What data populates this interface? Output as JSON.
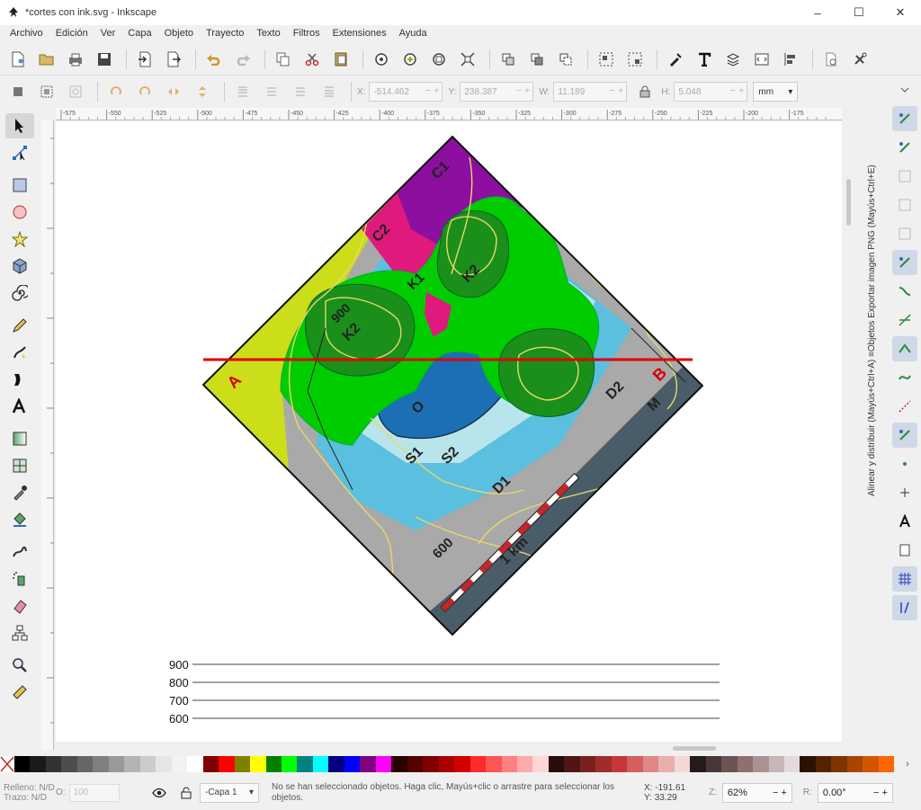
{
  "window": {
    "title": "*cortes con ink.svg - Inkscape",
    "controls": [
      "–",
      "☐",
      "✕"
    ]
  },
  "menu": [
    "Archivo",
    "Edición",
    "Ver",
    "Capa",
    "Objeto",
    "Trayecto",
    "Texto",
    "Filtros",
    "Extensiones",
    "Ayuda"
  ],
  "coords": {
    "x_label": "X:",
    "x_value": "-514.462",
    "y_label": "Y:",
    "y_value": "238.387",
    "w_label": "W:",
    "w_value": "11.189",
    "h_label": "H:",
    "h_value": "5.048",
    "unit": "mm"
  },
  "ruler": {
    "labels": [
      "-575",
      "-550",
      "-525",
      "-500",
      "-475",
      "-450",
      "-425",
      "-400",
      "-375",
      "-350",
      "-325",
      "-300",
      "-275",
      "-250",
      "-225",
      "-200",
      "-175"
    ]
  },
  "map": {
    "labels": {
      "c1": "C1",
      "c2": "C2",
      "k1": "K1",
      "k2a": "K2",
      "k2b": "K2",
      "c900": "900",
      "o": "O",
      "s1": "S1",
      "s2": "S2",
      "d1": "D1",
      "d2": "D2",
      "m": "M",
      "c600": "600",
      "scale": "1 km",
      "a": "A",
      "b": "B"
    }
  },
  "profile": {
    "levels": [
      "900",
      "800",
      "700",
      "600"
    ]
  },
  "dock": {
    "text": "Alinear y distribuir (Mayús+Ctrl+A)  ≡Objetos  Exportar imagen PNG (Mayús+Ctrl+E)"
  },
  "palette": {
    "colors": [
      "#000000",
      "#1a1a1a",
      "#333333",
      "#4d4d4d",
      "#666666",
      "#808080",
      "#999999",
      "#b3b3b3",
      "#cccccc",
      "#e6e6e6",
      "#f2f2f2",
      "#ffffff",
      "#800000",
      "#ff0000",
      "#808000",
      "#ffff00",
      "#008000",
      "#00ff00",
      "#008080",
      "#00ffff",
      "#000080",
      "#0000ff",
      "#800080",
      "#ff00ff",
      "#2b0000",
      "#550000",
      "#800000",
      "#aa0000",
      "#d40000",
      "#ff2a2a",
      "#ff5555",
      "#ff8080",
      "#ffaaaa",
      "#ffd5d5",
      "#280b0b",
      "#501616",
      "#782121",
      "#a02c2c",
      "#c83737",
      "#d35f5f",
      "#de8787",
      "#e9afaf",
      "#f4d7d7",
      "#241c1c",
      "#483737",
      "#6c5353",
      "#916f6f",
      "#ac9393",
      "#c8b7b7",
      "#e3dbdb",
      "#2b1100",
      "#552200",
      "#803300",
      "#aa4400",
      "#d45500",
      "#ff6600"
    ]
  },
  "status": {
    "fill_label": "Relleno:",
    "fill_value": "N/D",
    "stroke_label": "Trazo:",
    "stroke_value": "N/D",
    "opacity_label": "O:",
    "opacity_value": "100",
    "layer": "-Capa 1",
    "message": "No se han seleccionado objetos. Haga clic, Mayús+clic o arrastre para seleccionar los objetos.",
    "x_label": "X:",
    "x_value": "-191.61",
    "y_label": "Y:",
    "y_value": "33.29",
    "zoom_label": "Z:",
    "zoom_value": "62%",
    "rot_label": "R:",
    "rot_value": "0.00°"
  }
}
